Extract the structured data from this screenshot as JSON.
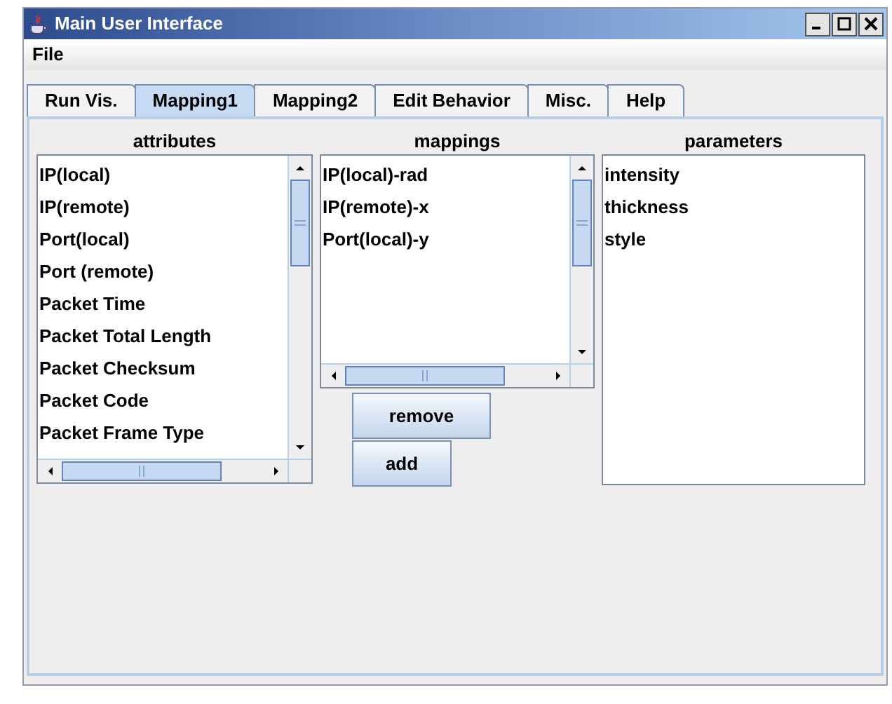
{
  "window": {
    "title": "Main User Interface"
  },
  "menu": [
    "File"
  ],
  "tabs": [
    {
      "label": "Run Vis.",
      "selected": false
    },
    {
      "label": "Mapping1",
      "selected": true
    },
    {
      "label": "Mapping2",
      "selected": false
    },
    {
      "label": "Edit Behavior",
      "selected": false
    },
    {
      "label": "Misc.",
      "selected": false
    },
    {
      "label": "Help",
      "selected": false
    }
  ],
  "attributes": {
    "heading": "attributes",
    "items": [
      "IP(local)",
      "IP(remote)",
      "Port(local)",
      "Port (remote)",
      "Packet Time",
      "Packet Total Length",
      "Packet Checksum",
      "Packet Code",
      "Packet Frame Type"
    ]
  },
  "mappings": {
    "heading": "mappings",
    "items": [
      "IP(local)-rad",
      "IP(remote)-x",
      "Port(local)-y"
    ]
  },
  "buttons": [
    "remove",
    "add"
  ],
  "parameters": {
    "heading": "parameters",
    "items": [
      "intensity",
      "thickness",
      "style"
    ]
  }
}
